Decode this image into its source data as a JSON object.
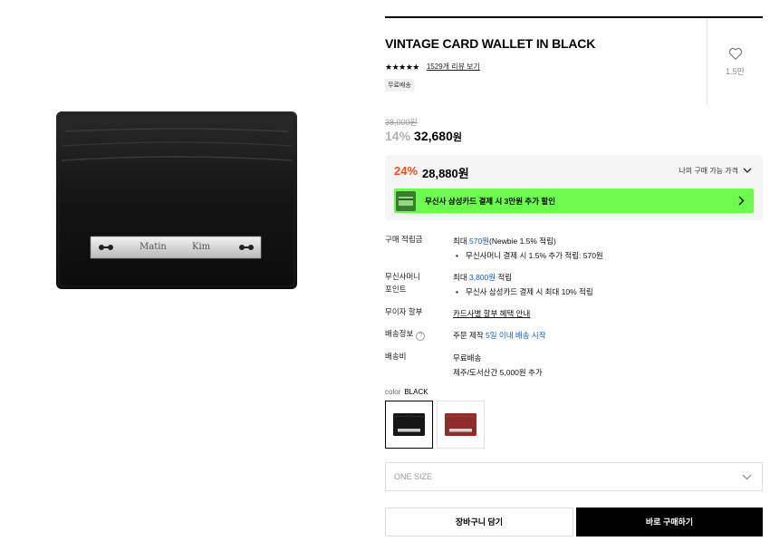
{
  "product": {
    "title": "VINTAGE CARD WALLET IN BLACK",
    "stars": "★★★★★",
    "reviews": "1529개 리뷰 보기",
    "shipping_badge": "무료배송",
    "likes": "1.5만",
    "plate_text_1": "Matin",
    "plate_text_2": "Kim"
  },
  "pricing": {
    "original": "38,000원",
    "discount": "14%",
    "price": "32,680",
    "price_unit": "원",
    "my_discount": "24%",
    "my_price": "28,880원",
    "my_price_link": "나의 구매 가능 가격",
    "banner_text": "무신사 삼성카드 결제 시 3만원 추가 할인"
  },
  "info": {
    "points_label": "구매 적립금",
    "points_prefix": "최대 ",
    "points_amount": "570원",
    "points_suffix": "(Newbie 1.5% 적립)",
    "points_bullet": "무신사머니 결제 시 1.5% 추가 적립: 570원",
    "musinsa_point_label_1": "무신사머니",
    "musinsa_point_label_2": "포인트",
    "musinsa_point_prefix": "최대 ",
    "musinsa_point_amount": "3,800원",
    "musinsa_point_suffix": " 적립",
    "musinsa_point_bullet": "무신사 삼성카드 결제 시 최대 10% 적립",
    "installment_label": "무이자 할부",
    "installment_value": "카드사별 할부 혜택 안내",
    "delivery_label": "배송정보",
    "delivery_prefix": "주문 제작 ",
    "delivery_highlight": "5일 이내 배송 시작",
    "fee_label": "배송비",
    "fee_line_1": "무료배송",
    "fee_line_2": "제주/도서산간 5,000원 추가"
  },
  "options": {
    "color_label": "color",
    "color_value": "BLACK",
    "size_placeholder": "ONE SIZE"
  },
  "buttons": {
    "cart": "장바구니 담기",
    "buy": "바로 구매하기"
  },
  "colors": {
    "accent_orange": "#f2501a",
    "banner_green": "#6dfa4f",
    "link_blue": "#0b5cd6"
  }
}
